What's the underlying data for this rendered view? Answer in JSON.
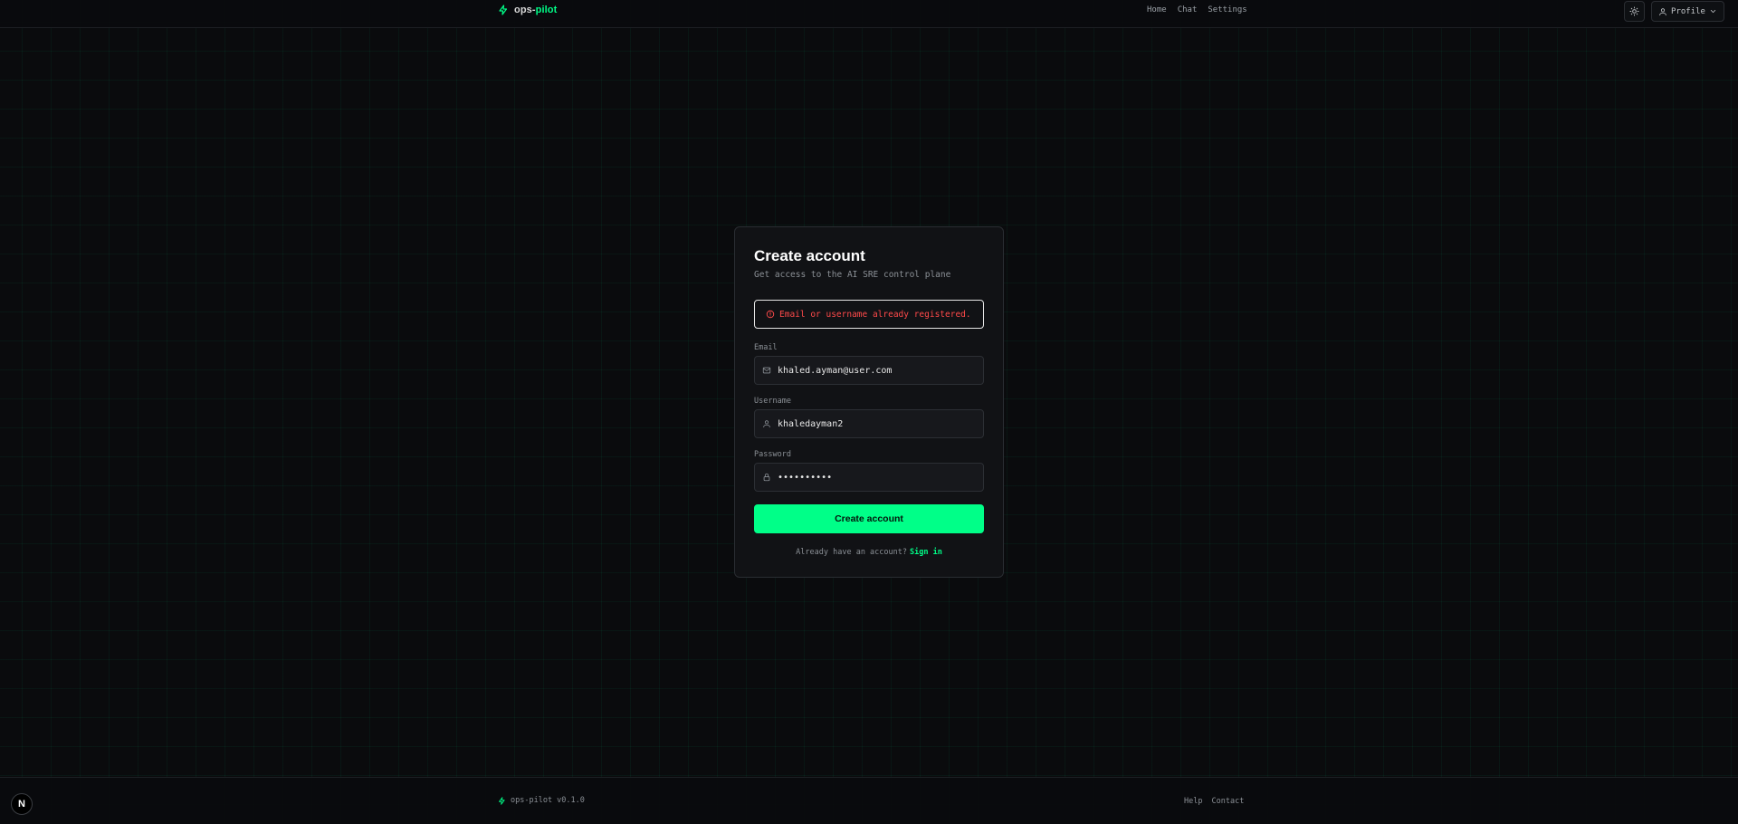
{
  "header": {
    "brand_prefix": "ops-",
    "brand_suffix": "pilot",
    "nav": [
      "Home",
      "Chat",
      "Settings"
    ],
    "profile_label": "Profile",
    "icons": {
      "logo": "lightning-bolt-icon",
      "theme": "sun-icon",
      "profile": "user-icon",
      "profile_caret": "chevron-down-icon"
    }
  },
  "form": {
    "title": "Create account",
    "subtitle": "Get access to the AI SRE control plane",
    "error": "Email or username already registered.",
    "email_label": "Email",
    "email_value": "khaled.ayman@user.com",
    "username_label": "Username",
    "username_value": "khaledayman2",
    "password_label": "Password",
    "password_value": "••••••••••",
    "submit_label": "Create account",
    "signin_prompt": "Already have an account?",
    "signin_link": "Sign in"
  },
  "footer": {
    "version": "ops-pilot v0.1.0",
    "links": [
      "Help",
      "Contact"
    ],
    "badge": "N"
  },
  "colors": {
    "accent": "#00ff88",
    "error": "#ff4a4a",
    "background": "#0a0b0d",
    "card": "#111215"
  }
}
